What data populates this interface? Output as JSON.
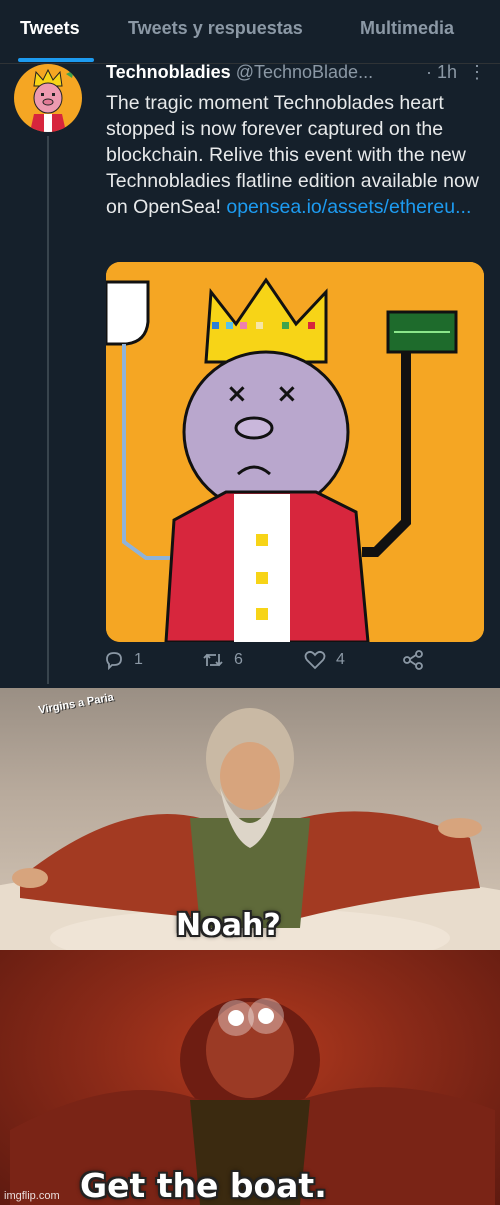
{
  "tabs": [
    {
      "label": "Tweets",
      "active": true
    },
    {
      "label": "Tweets y respuestas",
      "active": false
    },
    {
      "label": "Multimedia",
      "active": false
    }
  ],
  "tweet": {
    "display_name": "Technobladies",
    "handle": "@TechnoBlade...",
    "time": "· 1h",
    "more_icon": "vertical-dots-icon",
    "text": "The tragic moment Technoblades heart stopped is now forever captured on the blockchain. Relive this event with the new Technobladies flatline edition available now on OpenSea!",
    "link_line1": "opensea.io/",
    "link_line2": "assets/ethereu...",
    "actions": {
      "reply": {
        "icon": "reply-icon",
        "count": "1"
      },
      "retweet": {
        "icon": "retweet-icon",
        "count": "6"
      },
      "like": {
        "icon": "heart-icon",
        "count": "4"
      },
      "share": {
        "icon": "share-icon"
      }
    }
  },
  "meme": {
    "panel1_small_caption": "Virgins a Paria",
    "panel1_caption": "Noah?",
    "panel2_caption": "Get the boat.",
    "watermark": "imgflip.com"
  },
  "colors": {
    "background": "#15202b",
    "accent": "#1d9bf0",
    "muted": "#8b98a5",
    "nft_background": "#f5a623"
  }
}
